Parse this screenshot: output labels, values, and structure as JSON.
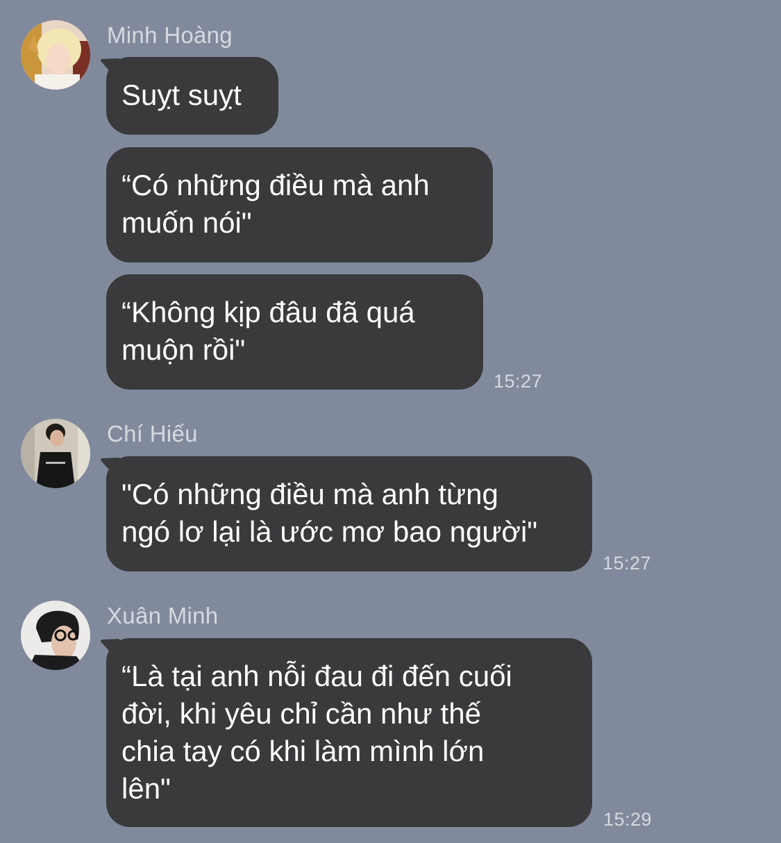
{
  "messages": [
    {
      "sender": "Minh Hoàng",
      "avatar_icon": "blonde-person-avatar-icon",
      "bubbles": [
        {
          "text": "Suỵt suỵt"
        },
        {
          "text": "“Có những điều mà anh\nmuốn nói\""
        },
        {
          "text": "“Không kịp đâu đã quá\nmuộn rồi\""
        }
      ],
      "time": "15:27"
    },
    {
      "sender": "Chí Hiếu",
      "avatar_icon": "dark-hair-person-avatar-icon",
      "bubbles": [
        {
          "text": "\"Có những điều mà anh từng\nngó lơ lại là ước mơ bao người\""
        }
      ],
      "time": "15:27"
    },
    {
      "sender": "Xuân Minh",
      "avatar_icon": "glasses-person-avatar-icon",
      "bubbles": [
        {
          "text": "“Là tại anh nỗi đau đi đến cuối\nđời, khi yêu chỉ cần như thế\nchia tay có khi làm mình lớn\nlên\""
        }
      ],
      "time": "15:29"
    }
  ],
  "colors": {
    "background": "#818a9c",
    "bubble": "#3a3a3c",
    "bubble_text": "#ffffff",
    "meta_text": "#d6d9e0"
  }
}
